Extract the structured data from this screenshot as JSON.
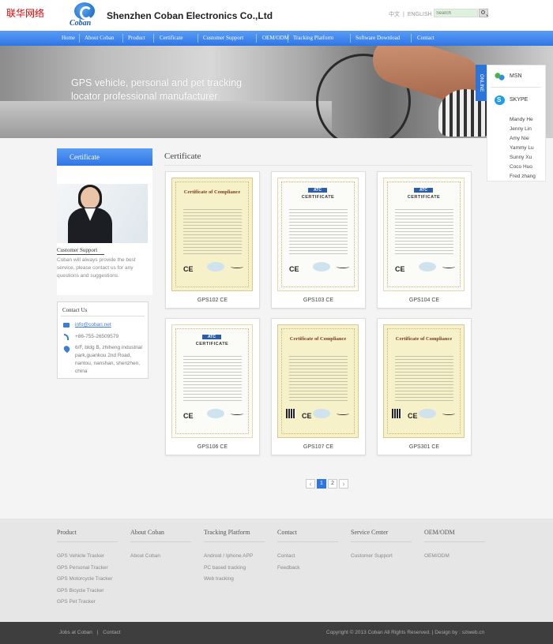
{
  "header": {
    "watermark": "联华网络",
    "logo_text": "Coban",
    "company": "Shenzhen Coban Electronics Co.,Ltd",
    "lang_cn": "中文",
    "lang_sep": "|",
    "lang_en": "ENGLISH",
    "search_placeholder": "Search"
  },
  "nav": [
    "Home",
    "About Coban",
    "Product",
    "Certificate",
    "Customer Support",
    "OEM/ODM",
    "Tracking Platform",
    "Software Download",
    "Contact"
  ],
  "banner": {
    "line1": "GPS vehicle, personal and pet tracking",
    "line2": "locator professional manufacturer"
  },
  "online": {
    "tab": "ONLINE",
    "msn": "MSN",
    "skype": "SKYPE",
    "names": [
      "Mandy He",
      "Jenny Lin",
      "Amy Nie",
      "Yammy Lu",
      "Sunny Xu",
      "Coco Huo",
      "Fred zhang"
    ]
  },
  "sidebar": {
    "heading": "Certificate",
    "cs_title": "Customer Support",
    "cs_text": "Coban will always provide the best service, please contact us for any questions and suggestions.",
    "contact_title": "Contact Us",
    "email": "info@coban.net",
    "phone": "+86-755-26509579",
    "address": "6/F, bldg B, zhiheng industrial park,guankou 2nd Road, nantou, nanshan, shenzhen, china"
  },
  "main": {
    "title": "Certificate",
    "certs": [
      {
        "label": "GPS102 CE",
        "style": "yellow",
        "head": "Certificate of Compliance"
      },
      {
        "label": "GPS103 CE",
        "style": "white",
        "head": "ATC"
      },
      {
        "label": "GPS104 CE",
        "style": "white",
        "head": "ATC"
      },
      {
        "label": "GPS106 CE",
        "style": "white",
        "head": "ATC"
      },
      {
        "label": "GPS107 CE",
        "style": "yellow",
        "head": "Certificate of Compliance"
      },
      {
        "label": "GPS301 CE",
        "style": "yellow",
        "head": "Certificate of Compliance"
      }
    ],
    "cert_sub": "CERTIFICATE",
    "cert_ce": "CE"
  },
  "pagination": {
    "prev": "‹",
    "pages": [
      "1",
      "2"
    ],
    "current": "1",
    "next": "›"
  },
  "footer": {
    "columns": [
      {
        "head": "Product",
        "links": [
          "GPS Vehicle Tracker",
          "GPS Personal Tracker",
          "GPS Motorcycle Tracker",
          "GPS Bicycle Tracker",
          "GPS Pet Tracker"
        ]
      },
      {
        "head": "About Coban",
        "links": [
          "About Coban"
        ]
      },
      {
        "head": "Tracking Platform",
        "links": [
          "Android / Iphone APP",
          "PC based tracking",
          "Web tracking"
        ]
      },
      {
        "head": "Contact",
        "links": [
          "Contact",
          "Feedback"
        ]
      },
      {
        "head": "Service Center",
        "links": [
          "Customer Support"
        ]
      },
      {
        "head": "OEM/ODM",
        "links": [
          "OEM/ODM"
        ]
      }
    ],
    "bottom_left": [
      "Jobs at Coban",
      "|",
      "Contact"
    ],
    "copyright": "Copyright © 2013 Coban All Rights Reserved. | Design by : sziweb.cn"
  },
  "colors": {
    "nav_blue": "#2e76e6",
    "accent": "#3b7ed6"
  },
  "icons": [
    "search-icon",
    "msn-icon",
    "skype-icon",
    "mail-icon",
    "phone-icon",
    "location-icon"
  ]
}
